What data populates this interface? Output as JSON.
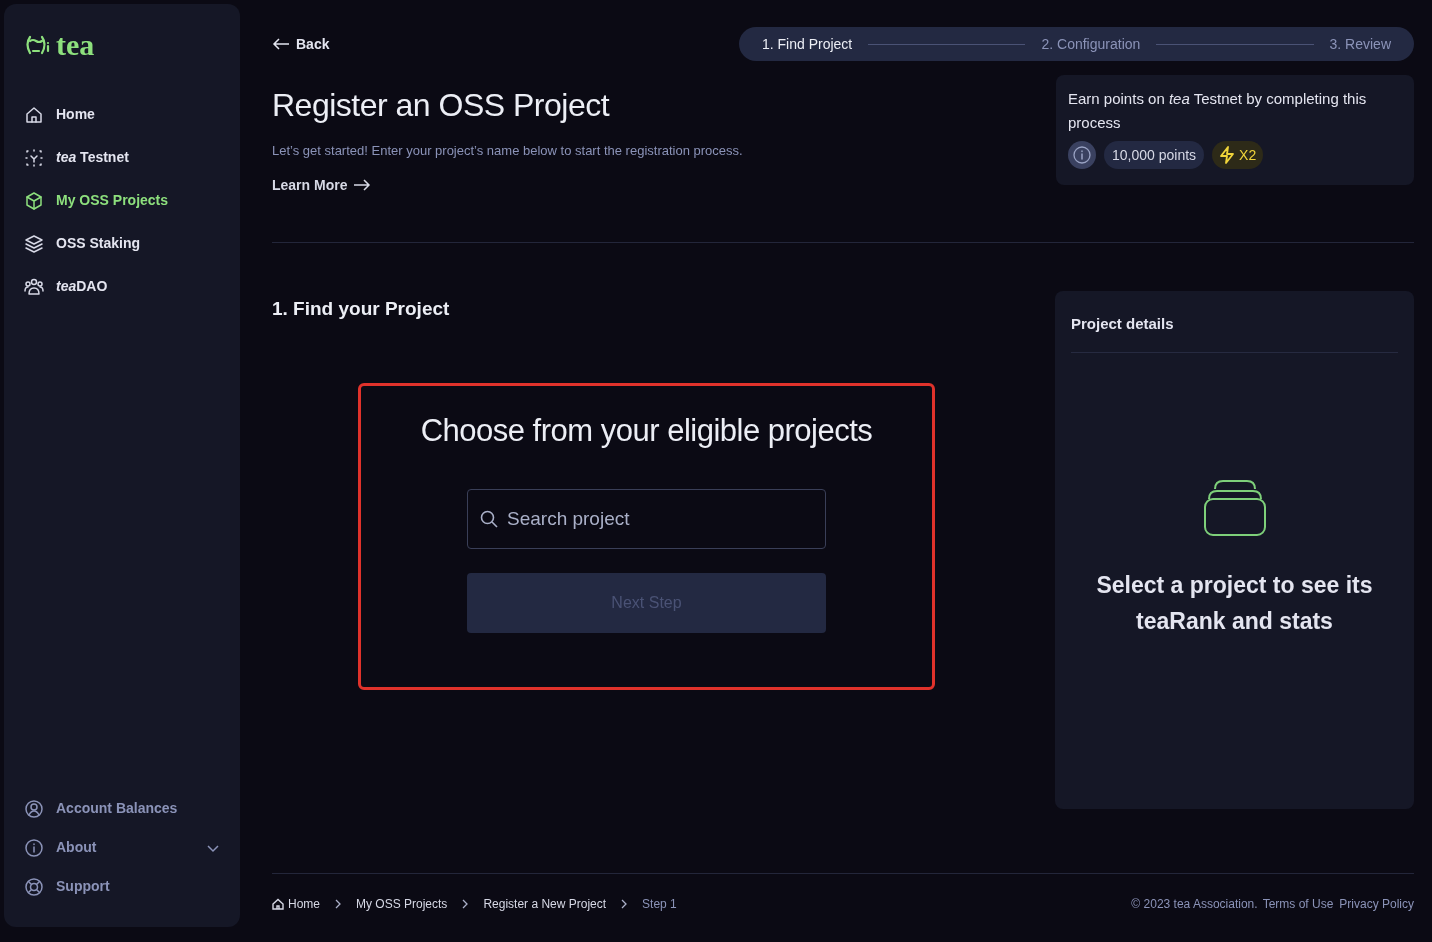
{
  "logo": {
    "text": "tea"
  },
  "sidebar": {
    "items": [
      {
        "label": "Home",
        "selected": false
      },
      {
        "label": "*tea* Testnet",
        "selected": false
      },
      {
        "label": "My OSS Projects",
        "selected": true
      },
      {
        "label": "OSS Staking",
        "selected": false
      },
      {
        "brand": "tea",
        "label": "DAO",
        "selected": false
      }
    ],
    "bottom_items": [
      {
        "label": "Account Balances",
        "expandable": false
      },
      {
        "label": "About",
        "expandable": true
      },
      {
        "label": "Support",
        "expandable": false
      }
    ]
  },
  "back": "Back",
  "steps": [
    {
      "label": "1. Find Project",
      "selected": true
    },
    {
      "label": "2. Configuration",
      "selected": false
    },
    {
      "label": "3. Review",
      "selected": false
    }
  ],
  "header": {
    "title": "Register an OSS Project",
    "subtitle": "Let’s get started! Enter your project’s name below to start the registration process.",
    "link": "Learn More"
  },
  "points_card": {
    "text": "Earn points on *tea* Testnet by completing this process",
    "points": "10,000 points",
    "multiplier": "X2"
  },
  "section_title": "1. Find your Project",
  "chooser": {
    "title": "Choose from your eligible projects",
    "search": {
      "placeholder": "Search project"
    },
    "button": {
      "label": "Next Step",
      "disabled": true
    }
  },
  "details": {
    "title": "Project details",
    "empty_text": "Select a project to see its teaRank and stats"
  },
  "breadcrumbs": [
    "Home",
    "My OSS Projects",
    "Register a New Project",
    "Step 1"
  ],
  "footer": {
    "copyright": "© 2023 tea Association.",
    "links": [
      "Terms of Use",
      "Privacy Policy"
    ]
  }
}
